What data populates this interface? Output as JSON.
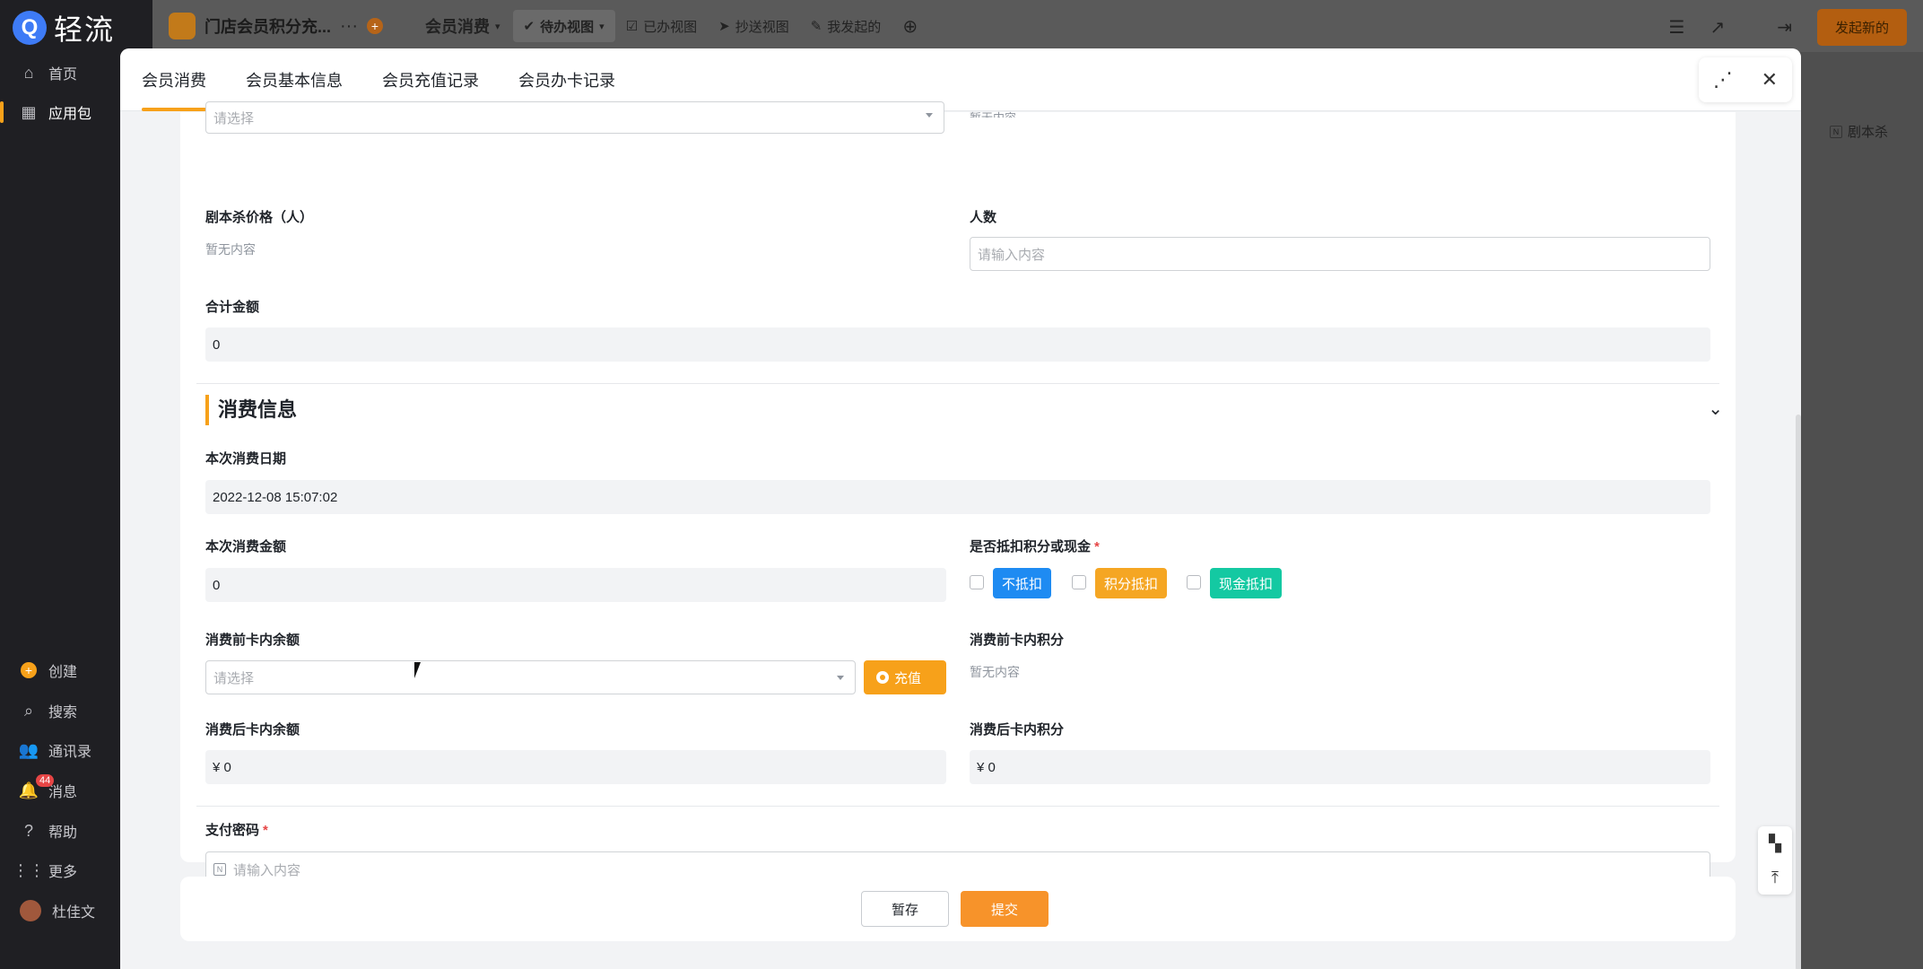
{
  "sidebar": {
    "logo_mark": "Q",
    "logo_text": "轻流",
    "items": [
      {
        "label": "首页",
        "icon": "home-icon"
      },
      {
        "label": "应用包",
        "icon": "grid-icon"
      }
    ],
    "bottom_items": [
      {
        "label": "创建",
        "icon": "plus-circle-icon"
      },
      {
        "label": "搜索",
        "icon": "search-icon"
      },
      {
        "label": "通讯录",
        "icon": "contacts-icon"
      },
      {
        "label": "消息",
        "icon": "bell-icon",
        "badge": "44"
      },
      {
        "label": "帮助",
        "icon": "help-icon"
      },
      {
        "label": "更多",
        "icon": "more-dots-icon"
      },
      {
        "label": "杜佳文",
        "icon": "avatar"
      }
    ]
  },
  "topbar": {
    "app_name": "门店会员积分充...",
    "more": "···",
    "current_form": "会员消费",
    "views": [
      "待办视图",
      "已办视图",
      "抄送视图",
      "我发起的"
    ],
    "start_button": "发起新的",
    "board_column": "剧本杀"
  },
  "modal": {
    "tabs": [
      "会员消费",
      "会员基本信息",
      "会员充值记录",
      "会员办卡记录"
    ],
    "active_tab": 0,
    "top_select_placeholder": "请选择",
    "top_right_cut_text": "暂无内容",
    "fields": {
      "script_price_label": "剧本杀价格（人）",
      "script_price_value": "暂无内容",
      "people_label": "人数",
      "people_placeholder": "请输入内容",
      "total_label": "合计金额",
      "total_value": "0"
    },
    "section_title": "消费信息",
    "consume": {
      "date_label": "本次消费日期",
      "date_value": "2022-12-08 15:07:02",
      "amount_label": "本次消费金额",
      "amount_value": "0",
      "deduct_label": "是否抵扣积分或现金",
      "deduct_required": "*",
      "deduct_options": [
        {
          "label": "不抵扣",
          "color": "#1e8bf2"
        },
        {
          "label": "积分抵扣",
          "color": "#f5a623"
        },
        {
          "label": "现金抵扣",
          "color": "#14c9a2"
        }
      ],
      "balance_before_label": "消费前卡内余额",
      "balance_before_placeholder": "请选择",
      "recharge_button": "充值",
      "points_before_label": "消费前卡内积分",
      "points_before_value": "暂无内容",
      "balance_after_label": "消费后卡内余额",
      "balance_after_value": "¥ 0",
      "points_after_label": "消费后卡内积分",
      "points_after_value": "¥ 0",
      "password_label": "支付密码",
      "password_required": "*",
      "password_placeholder": "请输入内容"
    },
    "actions": {
      "save": "暂存",
      "submit": "提交"
    }
  },
  "colors": {
    "accent": "#f7a11a",
    "submit": "#f7932a"
  }
}
